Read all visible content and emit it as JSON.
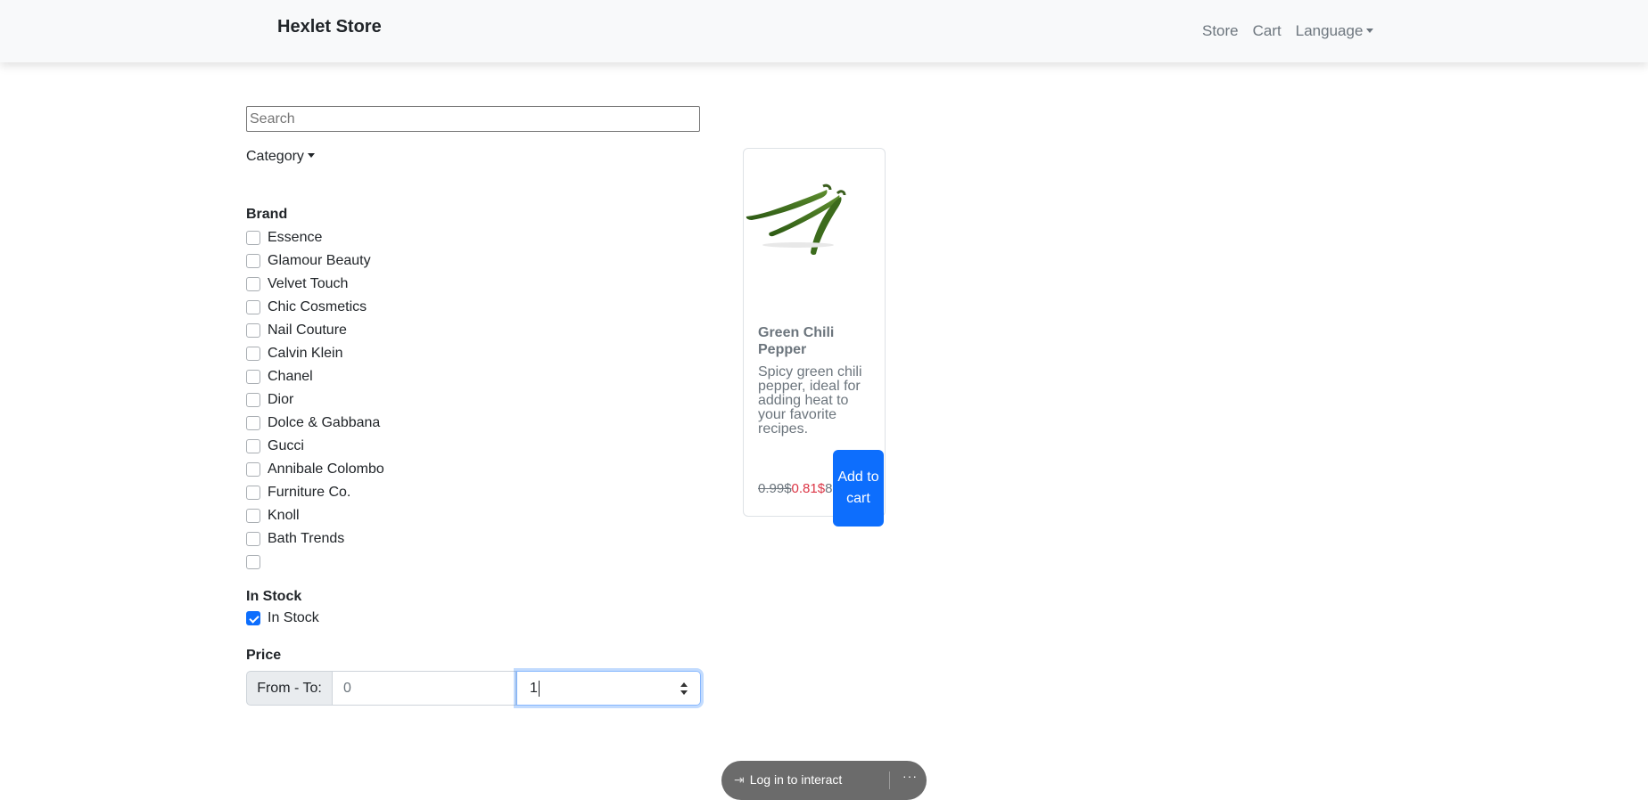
{
  "navbar": {
    "brand": "Hexlet Store",
    "links": [
      "Store",
      "Cart",
      "Language"
    ]
  },
  "search": {
    "placeholder": "Search",
    "value": ""
  },
  "filters": {
    "category_label": "Category",
    "brand_title": "Brand",
    "brands": [
      "Essence",
      "Glamour Beauty",
      "Velvet Touch",
      "Chic Cosmetics",
      "Nail Couture",
      "Calvin Klein",
      "Chanel",
      "Dior",
      "Dolce & Gabbana",
      "Gucci",
      "Annibale Colombo",
      "Furniture Co.",
      "Knoll",
      "Bath Trends",
      ""
    ],
    "in_stock_title": "In Stock",
    "in_stock_label": "In Stock",
    "in_stock_checked": true,
    "price_title": "Price",
    "price_label": "From - To:",
    "price_from": "0",
    "price_to": "1"
  },
  "product": {
    "title": "Green Chili Pepper",
    "description": "Spicy green chili pepper, ideal for adding heat to your favorite recipes.",
    "old_price": "0.99$",
    "new_price": "0.81$",
    "extra": "8",
    "add_button": "Add to cart"
  },
  "overlay": {
    "login_text": "Log in to interact",
    "more": "···"
  },
  "colors": {
    "primary": "#0d6efd",
    "sale": "#dc3545",
    "muted": "#6c757d"
  }
}
